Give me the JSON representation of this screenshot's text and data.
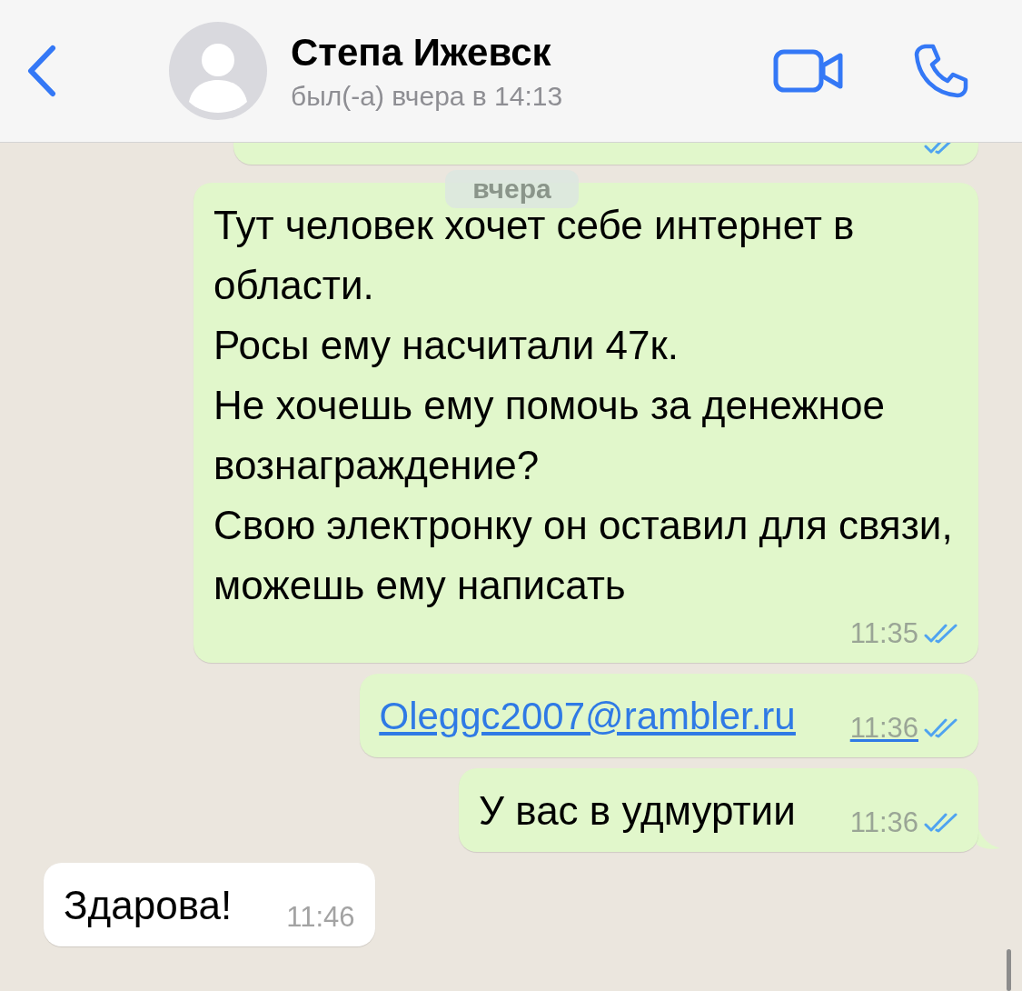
{
  "header": {
    "contact_name": "Степа Ижевск",
    "status": "был(-а) вчера в 14:13"
  },
  "messages": [
    {
      "outgoing": true,
      "kind": "cut",
      "read": true
    },
    {
      "outgoing": true,
      "kind": "text",
      "text": "Тут человек хочет себе интернет в области.\nРосы ему насчитали 47к.\nНе хочешь ему помочь за денежное вознаграждение?\nСвою электронку он оставил для связи, можешь ему написать",
      "time": "11:35",
      "read": true,
      "tail": false
    },
    {
      "outgoing": true,
      "kind": "link",
      "text": "Oleggc2007@rambler.ru",
      "time": "11:36",
      "read": true,
      "tail": false
    },
    {
      "outgoing": true,
      "kind": "text",
      "text": "У вас в удмуртии",
      "time": "11:36",
      "read": true,
      "tail": true
    },
    {
      "outgoing": false,
      "kind": "text",
      "text": "Здарова!",
      "time": "11:46",
      "tail": false
    }
  ],
  "date_separator": "вчера"
}
